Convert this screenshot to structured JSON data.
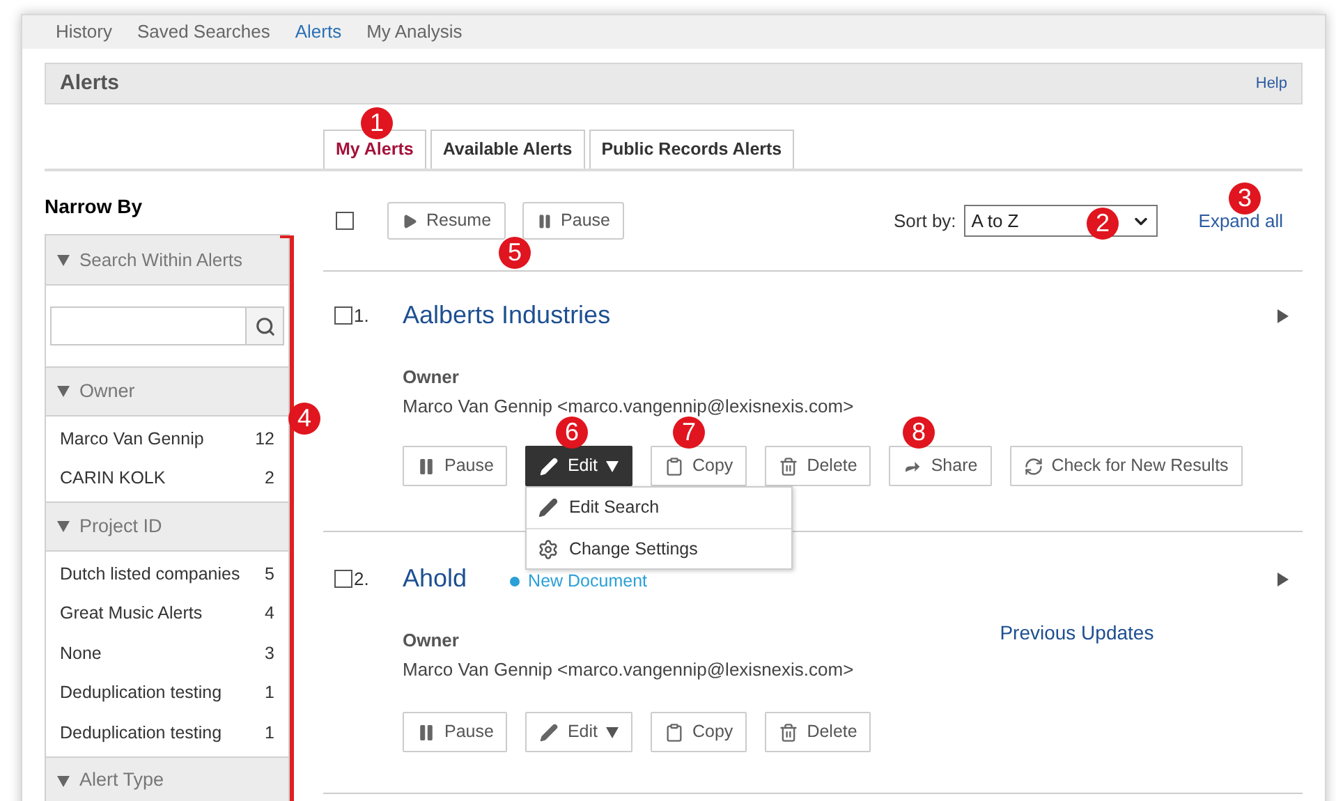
{
  "nav": [
    {
      "label": "History",
      "selected": false
    },
    {
      "label": "Saved Searches",
      "selected": false
    },
    {
      "label": "Alerts",
      "selected": true
    },
    {
      "label": "My Analysis",
      "selected": false
    }
  ],
  "header": {
    "title": "Alerts",
    "help": "Help"
  },
  "tabs": [
    {
      "label": "My Alerts",
      "selected": true
    },
    {
      "label": "Available Alerts",
      "selected": false
    },
    {
      "label": "Public Records Alerts",
      "selected": false
    }
  ],
  "narrow_by": {
    "title": "Narrow By",
    "search_group": "Search Within Alerts",
    "groups": [
      {
        "title": "Owner",
        "items": [
          {
            "label": "Marco Van Gennip",
            "count": "12"
          },
          {
            "label": "CARIN  KOLK",
            "count": "2"
          }
        ]
      },
      {
        "title": "Project ID",
        "items": [
          {
            "label": "Dutch listed companies",
            "count": "5"
          },
          {
            "label": "Great Music Alerts",
            "count": "4"
          },
          {
            "label": "None",
            "count": "3"
          },
          {
            "label": "Deduplication testing",
            "count": "1"
          },
          {
            "label": "Deduplication testing",
            "count": "1"
          }
        ]
      },
      {
        "title": "Alert Type"
      }
    ]
  },
  "toolbar": {
    "select_all_checked": false,
    "buttons": [
      {
        "label": "Resume",
        "kind": "play"
      },
      {
        "label": "Pause",
        "kind": "pause"
      }
    ],
    "sort_label": "Sort by:",
    "sort_value": "A to Z",
    "expand_all": "Expand all"
  },
  "alerts": [
    {
      "index": "1.",
      "checked": false,
      "title": "Aalberts Industries",
      "owner_label": "Owner",
      "owner": "Marco Van Gennip <marco.vangennip@lexisnexis.com>",
      "actions": [
        {
          "label": "Pause",
          "kind": "pause",
          "active": false
        },
        {
          "label": "Edit",
          "kind": "edit",
          "active": true
        },
        {
          "label": "Copy",
          "kind": "copy",
          "active": false
        },
        {
          "label": "Delete",
          "kind": "delete",
          "active": false
        },
        {
          "label": "Share",
          "kind": "share",
          "active": false
        },
        {
          "label": "Check for New Results",
          "kind": "refresh",
          "active": false
        }
      ],
      "menu": [
        {
          "label": "Edit Search",
          "kind": "edit"
        },
        {
          "label": "Change Settings",
          "kind": "gear"
        }
      ]
    },
    {
      "index": "2.",
      "checked": false,
      "title": "Ahold",
      "badge": "New Document",
      "owner_label": "Owner",
      "owner": "Marco Van Gennip <marco.vangennip@lexisnexis.com>",
      "previous_updates": "Previous Updates",
      "actions": [
        {
          "label": "Pause",
          "kind": "pause",
          "active": false
        },
        {
          "label": "Edit",
          "kind": "edit",
          "active": false
        },
        {
          "label": "Copy",
          "kind": "copy",
          "active": false
        },
        {
          "label": "Delete",
          "kind": "delete",
          "active": false
        }
      ]
    }
  ],
  "callouts": [
    "1",
    "2",
    "3",
    "4",
    "5",
    "6",
    "7",
    "8"
  ]
}
